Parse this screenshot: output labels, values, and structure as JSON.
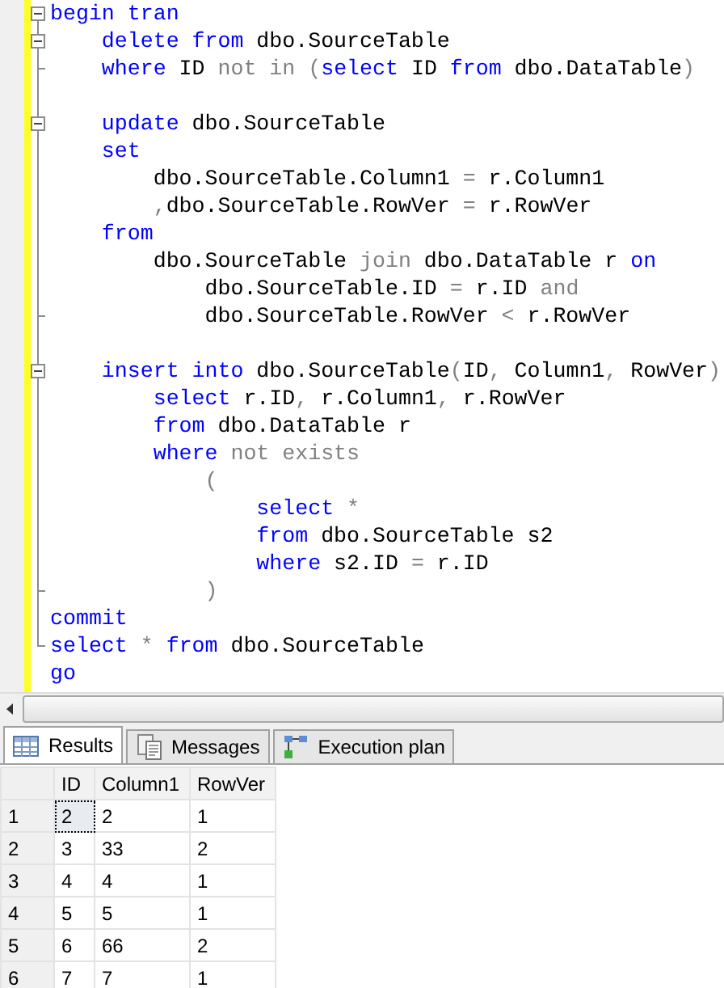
{
  "editor": {
    "lines": [
      {
        "kind": "start",
        "tokens": [
          {
            "kind": "kw",
            "text": "begin tran"
          }
        ]
      },
      {
        "kind": "start",
        "tokens": [
          {
            "kind": "kw",
            "text": "    delete from"
          },
          {
            "kind": "plain",
            "text": " dbo.SourceTable"
          }
        ]
      },
      {
        "kind": "end",
        "tokens": [
          {
            "kind": "kw",
            "text": "    where"
          },
          {
            "kind": "plain",
            "text": " ID "
          },
          {
            "kind": "op",
            "text": "not in ("
          },
          {
            "kind": "kw",
            "text": "select"
          },
          {
            "kind": "plain",
            "text": " ID "
          },
          {
            "kind": "kw",
            "text": "from"
          },
          {
            "kind": "plain",
            "text": " dbo.DataTable"
          },
          {
            "kind": "op",
            "text": ")"
          }
        ]
      },
      {
        "kind": "line"
      },
      {
        "kind": "start",
        "tokens": [
          {
            "kind": "kw",
            "text": "    update"
          },
          {
            "kind": "plain",
            "text": " dbo.SourceTable"
          }
        ]
      },
      {
        "kind": "line",
        "tokens": [
          {
            "kind": "kw",
            "text": "    set"
          }
        ]
      },
      {
        "kind": "line",
        "tokens": [
          {
            "kind": "plain",
            "text": "        dbo.SourceTable.Column1 "
          },
          {
            "kind": "op",
            "text": "="
          },
          {
            "kind": "plain",
            "text": " r.Column1"
          }
        ]
      },
      {
        "kind": "line",
        "tokens": [
          {
            "kind": "op",
            "text": "        ,"
          },
          {
            "kind": "plain",
            "text": "dbo.SourceTable.RowVer "
          },
          {
            "kind": "op",
            "text": "="
          },
          {
            "kind": "plain",
            "text": " r.RowVer"
          }
        ]
      },
      {
        "kind": "line",
        "tokens": [
          {
            "kind": "kw",
            "text": "    from"
          }
        ]
      },
      {
        "kind": "line",
        "tokens": [
          {
            "kind": "plain",
            "text": "        dbo.SourceTable "
          },
          {
            "kind": "op",
            "text": "join"
          },
          {
            "kind": "plain",
            "text": " dbo.DataTable r "
          },
          {
            "kind": "kw",
            "text": "on"
          }
        ]
      },
      {
        "kind": "line",
        "tokens": [
          {
            "kind": "plain",
            "text": "            dbo.SourceTable.ID "
          },
          {
            "kind": "op",
            "text": "="
          },
          {
            "kind": "plain",
            "text": " r.ID "
          },
          {
            "kind": "op",
            "text": "and"
          }
        ]
      },
      {
        "kind": "end",
        "tokens": [
          {
            "kind": "plain",
            "text": "            dbo.SourceTable.RowVer "
          },
          {
            "kind": "op",
            "text": "<"
          },
          {
            "kind": "plain",
            "text": " r.RowVer"
          }
        ]
      },
      {
        "kind": "line"
      },
      {
        "kind": "start",
        "tokens": [
          {
            "kind": "kw",
            "text": "    insert into"
          },
          {
            "kind": "plain",
            "text": " dbo.SourceTable"
          },
          {
            "kind": "op",
            "text": "("
          },
          {
            "kind": "plain",
            "text": "ID"
          },
          {
            "kind": "op",
            "text": ", "
          },
          {
            "kind": "plain",
            "text": "Column1"
          },
          {
            "kind": "op",
            "text": ", "
          },
          {
            "kind": "plain",
            "text": "RowVer"
          },
          {
            "kind": "op",
            "text": ")"
          }
        ]
      },
      {
        "kind": "line",
        "tokens": [
          {
            "kind": "kw",
            "text": "        select"
          },
          {
            "kind": "plain",
            "text": " r.ID"
          },
          {
            "kind": "op",
            "text": ", "
          },
          {
            "kind": "plain",
            "text": "r.Column1"
          },
          {
            "kind": "op",
            "text": ", "
          },
          {
            "kind": "plain",
            "text": "r.RowVer"
          }
        ]
      },
      {
        "kind": "line",
        "tokens": [
          {
            "kind": "kw",
            "text": "        from"
          },
          {
            "kind": "plain",
            "text": " dbo.DataTable r"
          }
        ]
      },
      {
        "kind": "line",
        "tokens": [
          {
            "kind": "kw",
            "text": "        where"
          },
          {
            "kind": "op",
            "text": " not exists"
          }
        ]
      },
      {
        "kind": "line",
        "tokens": [
          {
            "kind": "op",
            "text": "            ("
          }
        ]
      },
      {
        "kind": "line",
        "tokens": [
          {
            "kind": "kw",
            "text": "                select"
          },
          {
            "kind": "op",
            "text": " *"
          }
        ]
      },
      {
        "kind": "line",
        "tokens": [
          {
            "kind": "kw",
            "text": "                from"
          },
          {
            "kind": "plain",
            "text": " dbo.SourceTable s2"
          }
        ]
      },
      {
        "kind": "line",
        "tokens": [
          {
            "kind": "kw",
            "text": "                where"
          },
          {
            "kind": "plain",
            "text": " s2.ID "
          },
          {
            "kind": "op",
            "text": "="
          },
          {
            "kind": "plain",
            "text": " r.ID"
          }
        ]
      },
      {
        "kind": "end",
        "tokens": [
          {
            "kind": "op",
            "text": "            )"
          }
        ]
      },
      {
        "kind": "line",
        "tokens": [
          {
            "kind": "kw",
            "text": "commit"
          }
        ]
      },
      {
        "kind": "close",
        "tokens": [
          {
            "kind": "kw",
            "text": "select"
          },
          {
            "kind": "op",
            "text": " *"
          },
          {
            "kind": "kw",
            "text": " from"
          },
          {
            "kind": "plain",
            "text": " dbo.SourceTable"
          }
        ]
      },
      {
        "kind": "none",
        "tokens": [
          {
            "kind": "kw",
            "text": "go"
          }
        ]
      }
    ]
  },
  "tabs": [
    {
      "label": "Results",
      "selected": true
    },
    {
      "label": "Messages",
      "selected": false
    },
    {
      "label": "Execution plan",
      "selected": false
    }
  ],
  "grid": {
    "columns": [
      "ID",
      "Column1",
      "RowVer"
    ],
    "rows": [
      {
        "number": "1",
        "cells": [
          "2",
          "2",
          "1"
        ],
        "selected": true
      },
      {
        "number": "2",
        "cells": [
          "3",
          "33",
          "2"
        ],
        "selected": false
      },
      {
        "number": "3",
        "cells": [
          "4",
          "4",
          "1"
        ],
        "selected": false
      },
      {
        "number": "4",
        "cells": [
          "5",
          "5",
          "1"
        ],
        "selected": false
      },
      {
        "number": "5",
        "cells": [
          "6",
          "66",
          "2"
        ],
        "selected": false
      },
      {
        "number": "6",
        "cells": [
          "7",
          "7",
          "1"
        ],
        "selected": false
      }
    ]
  }
}
